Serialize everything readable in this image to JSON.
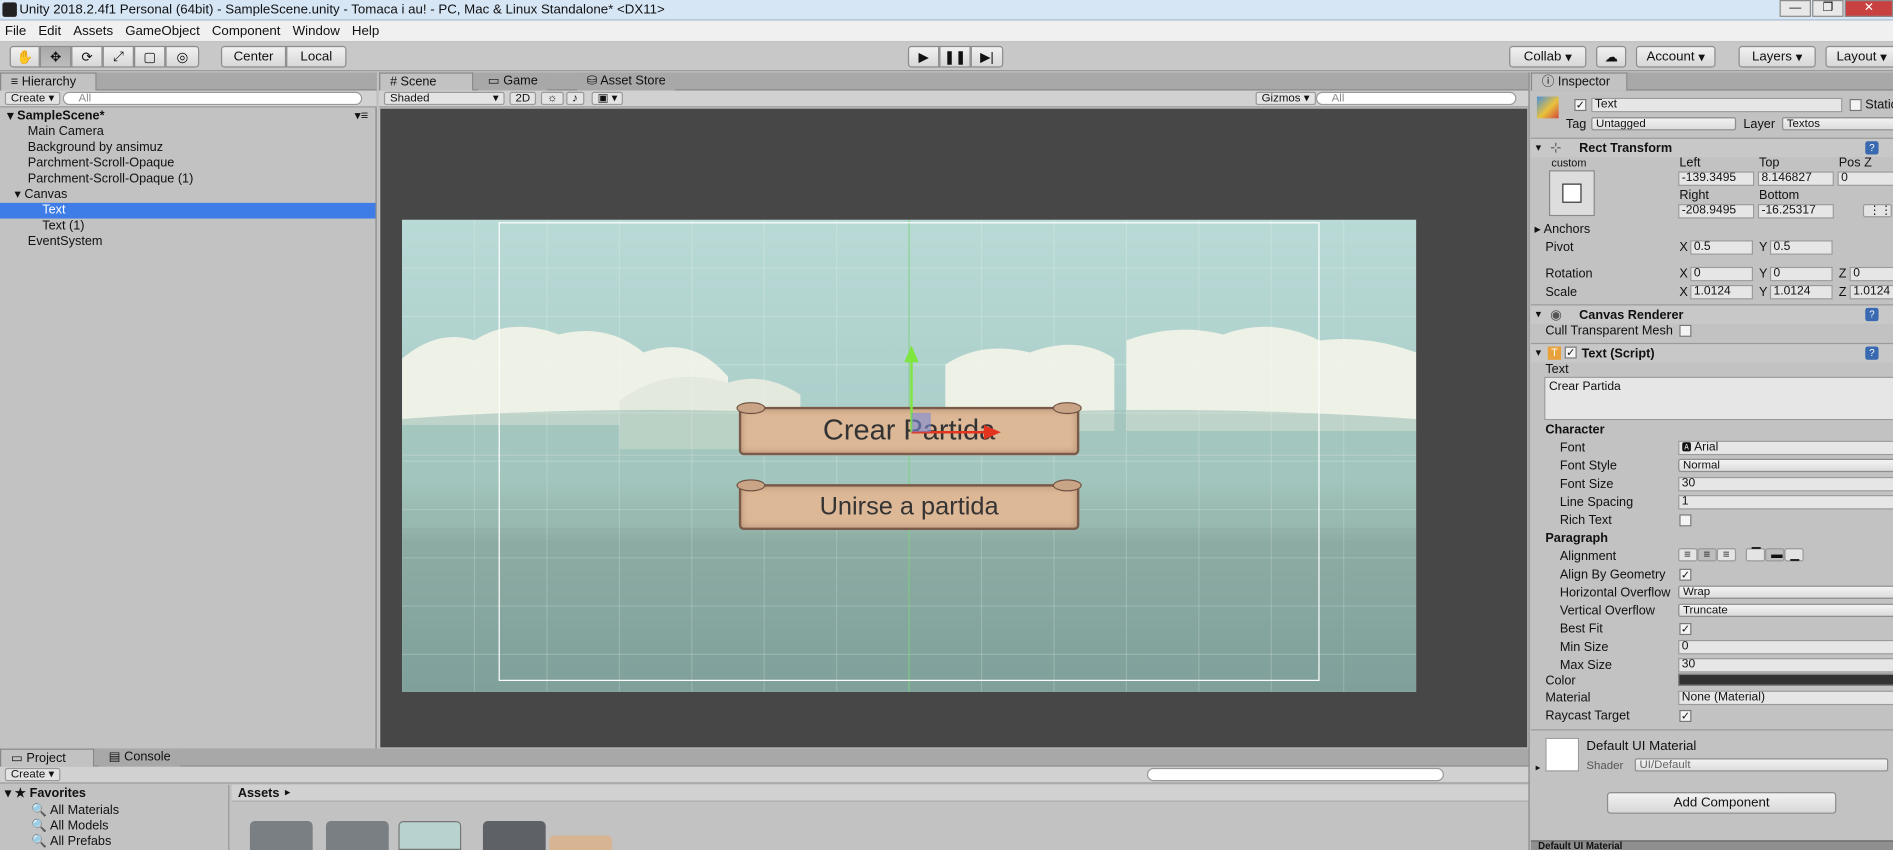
{
  "window": {
    "title": "Unity 2018.2.4f1 Personal (64bit) - SampleScene.unity - Tomaca i au! - PC, Mac & Linux Standalone* <DX11>"
  },
  "menu": [
    "File",
    "Edit",
    "Assets",
    "GameObject",
    "Component",
    "Window",
    "Help"
  ],
  "toolbar": {
    "pivot": "Center",
    "space": "Local",
    "collab": "Collab",
    "account": "Account",
    "layers": "Layers",
    "layout": "Layout"
  },
  "hierarchy": {
    "tab": "Hierarchy",
    "create": "Create",
    "search_placeholder": "All",
    "scene": "SampleScene*",
    "items": [
      "Main Camera",
      "Background by ansimuz",
      "Parchment-Scroll-Opaque",
      "Parchment-Scroll-Opaque (1)",
      "Canvas",
      "Text",
      "Text (1)",
      "EventSystem"
    ]
  },
  "scene_view": {
    "tabs": [
      "Scene",
      "Game",
      "Asset Store"
    ],
    "shading": "Shaded",
    "mode2d": "2D",
    "gizmos": "Gizmos",
    "search_placeholder": "All",
    "buttons": [
      "Crear Partida",
      "Unirse a partida"
    ]
  },
  "project": {
    "tabs": [
      "Project",
      "Console"
    ],
    "create": "Create",
    "favorites": "Favorites",
    "fav_items": [
      "All Materials",
      "All Models",
      "All Prefabs"
    ],
    "assets_label": "Assets"
  },
  "inspector": {
    "tab": "Inspector",
    "object_name": "Text",
    "static_label": "Static",
    "tag_label": "Tag",
    "tag_value": "Untagged",
    "layer_label": "Layer",
    "layer_value": "Textos",
    "rect_transform": {
      "title": "Rect Transform",
      "anchor_preset": "custom",
      "left_label": "Left",
      "left": "-139.3495",
      "top_label": "Top",
      "top": "8.146827",
      "posz_label": "Pos Z",
      "posz": "0",
      "right_label": "Right",
      "right": "-208.9495",
      "bottom_label": "Bottom",
      "bottom": "-16.25317",
      "anchors_label": "Anchors",
      "pivot_label": "Pivot",
      "pivot_x": "0.5",
      "pivot_y": "0.5",
      "rotation_label": "Rotation",
      "rot_x": "0",
      "rot_y": "0",
      "rot_z": "0",
      "scale_label": "Scale",
      "scale_x": "1.0124",
      "scale_y": "1.0124",
      "scale_z": "1.0124",
      "x": "X",
      "y": "Y",
      "z": "Z"
    },
    "canvas_renderer": {
      "title": "Canvas Renderer",
      "cull_label": "Cull Transparent Mesh"
    },
    "text_script": {
      "title": "Text (Script)",
      "text_label": "Text",
      "text_value": "Crear Partida",
      "character": "Character",
      "font_label": "Font",
      "font": "Arial",
      "font_style_label": "Font Style",
      "font_style": "Normal",
      "font_size_label": "Font Size",
      "font_size": "30",
      "line_spacing_label": "Line Spacing",
      "line_spacing": "1",
      "rich_text_label": "Rich Text",
      "paragraph": "Paragraph",
      "alignment_label": "Alignment",
      "align_geometry_label": "Align By Geometry",
      "h_overflow_label": "Horizontal Overflow",
      "h_overflow": "Wrap",
      "v_overflow_label": "Vertical Overflow",
      "v_overflow": "Truncate",
      "best_fit_label": "Best Fit",
      "min_size_label": "Min Size",
      "min_size": "0",
      "max_size_label": "Max Size",
      "max_size": "30",
      "color_label": "Color",
      "material_label": "Material",
      "material": "None (Material)",
      "raycast_label": "Raycast Target"
    },
    "material_section": {
      "name": "Default UI Material",
      "shader_label": "Shader",
      "shader": "UI/Default"
    },
    "add_component": "Add Component",
    "footer": "Default UI Material"
  }
}
